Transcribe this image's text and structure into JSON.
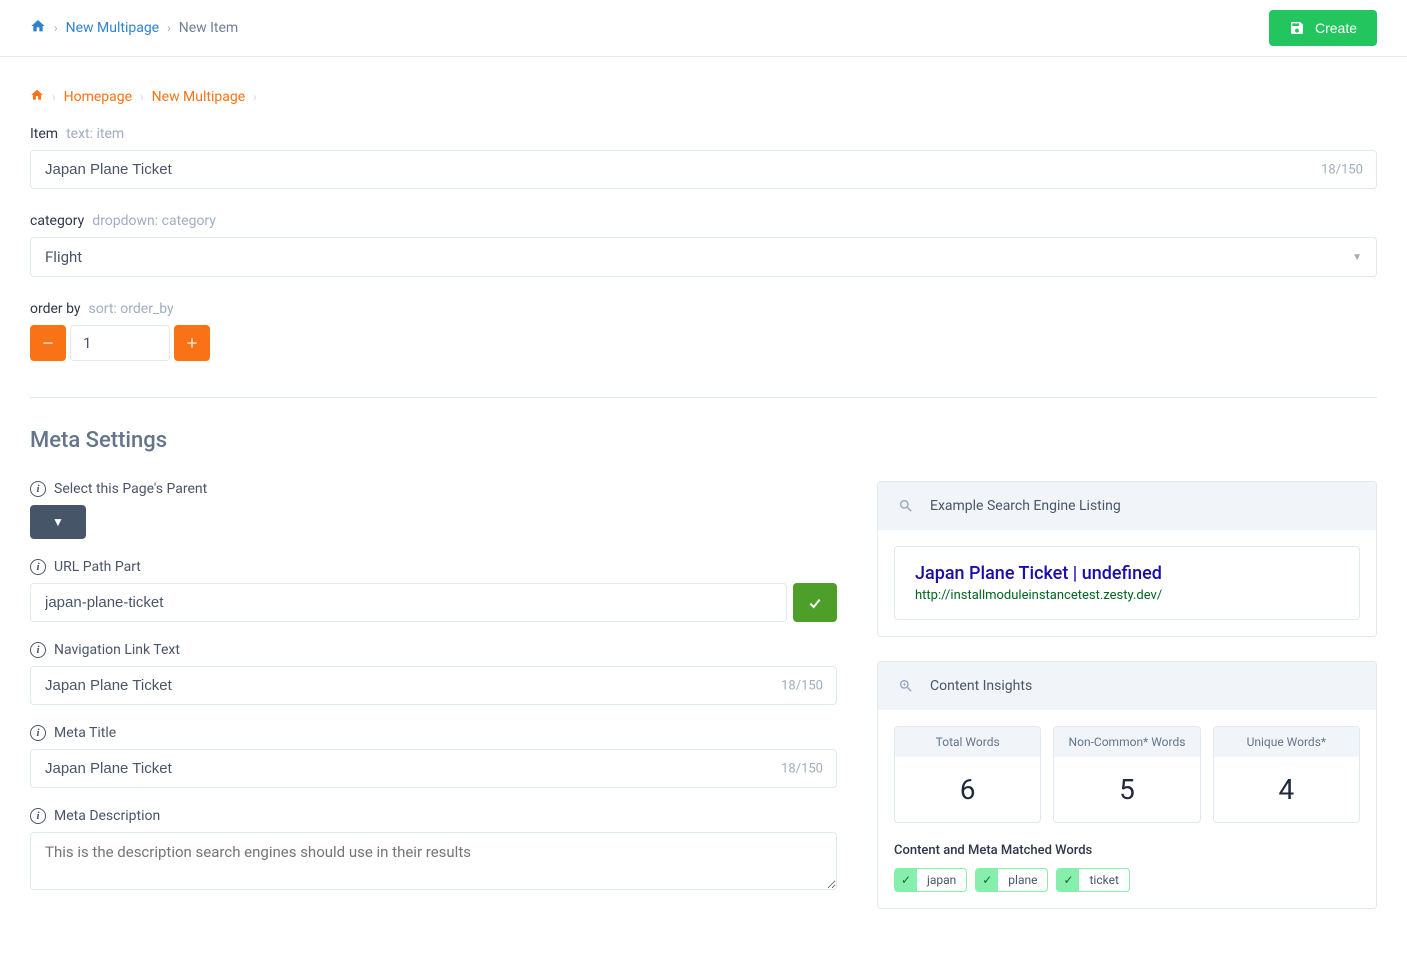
{
  "top_breadcrumb": {
    "new_multipage": "New Multipage",
    "new_item": "New Item"
  },
  "create_button": "Create",
  "orange_breadcrumb": {
    "homepage": "Homepage",
    "new_multipage": "New Multipage"
  },
  "item_field": {
    "label": "Item",
    "meta": "text: item",
    "value": "Japan Plane Ticket",
    "count": "18/150"
  },
  "category_field": {
    "label": "category",
    "meta": "dropdown: category",
    "value": "Flight"
  },
  "order_by_field": {
    "label": "order by",
    "meta": "sort: order_by",
    "value": "1"
  },
  "meta_settings": {
    "title": "Meta Settings",
    "parent_label": "Select this Page's Parent",
    "url_path_label": "URL Path Part",
    "url_path_value": "japan-plane-ticket",
    "nav_link_label": "Navigation Link Text",
    "nav_link_value": "Japan Plane Ticket",
    "nav_link_count": "18/150",
    "meta_title_label": "Meta Title",
    "meta_title_value": "Japan Plane Ticket",
    "meta_title_count": "18/150",
    "meta_desc_label": "Meta Description",
    "meta_desc_placeholder": "This is the description search engines should use in their results"
  },
  "serp": {
    "header": "Example Search Engine Listing",
    "title": "Japan Plane Ticket | undefined",
    "url": "http://installmoduleinstancetest.zesty.dev/"
  },
  "insights": {
    "header": "Content Insights",
    "total_words_label": "Total Words",
    "total_words_value": "6",
    "noncommon_label": "Non-Common* Words",
    "noncommon_value": "5",
    "unique_label": "Unique Words*",
    "unique_value": "4",
    "matched_label": "Content and Meta Matched Words",
    "tags": [
      "japan",
      "plane",
      "ticket"
    ]
  }
}
